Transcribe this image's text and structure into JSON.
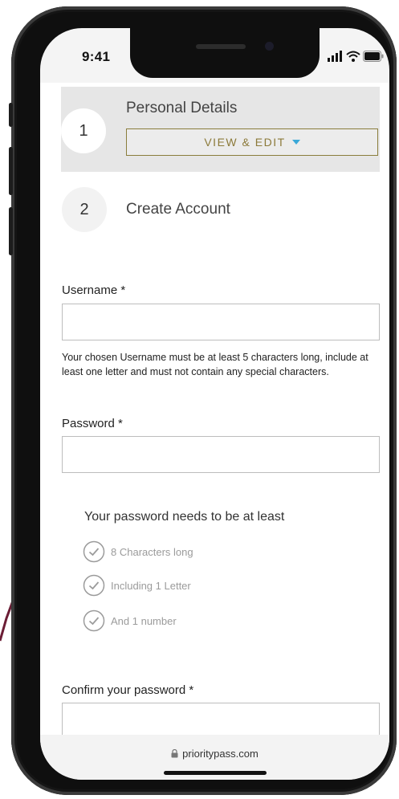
{
  "status_bar": {
    "time": "9:41"
  },
  "steps": [
    {
      "number": "1",
      "title": "Personal Details",
      "action": "VIEW & EDIT"
    },
    {
      "number": "2",
      "title": "Create Account"
    }
  ],
  "form": {
    "username": {
      "label": "Username *",
      "value": "",
      "help": "Your chosen Username must be at least 5 characters long, include at least one letter and must not contain any special characters."
    },
    "password": {
      "label": "Password *",
      "value": ""
    },
    "requirements": {
      "heading": "Your password needs to be at least",
      "items": [
        "8 Characters long",
        "Including 1 Letter",
        "And 1 number"
      ]
    },
    "confirm": {
      "label": "Confirm your password *",
      "value": ""
    }
  },
  "browser": {
    "url": "prioritypass.com"
  },
  "colors": {
    "accent_gold": "#8c7a3a",
    "caret_blue": "#3aa8d8",
    "step_bg": "#e6e6e6",
    "decor_line": "#6b1d35"
  },
  "icons": [
    "signal-icon",
    "wifi-icon",
    "battery-icon",
    "chevron-down-icon",
    "check-circle-icon",
    "lock-icon"
  ]
}
